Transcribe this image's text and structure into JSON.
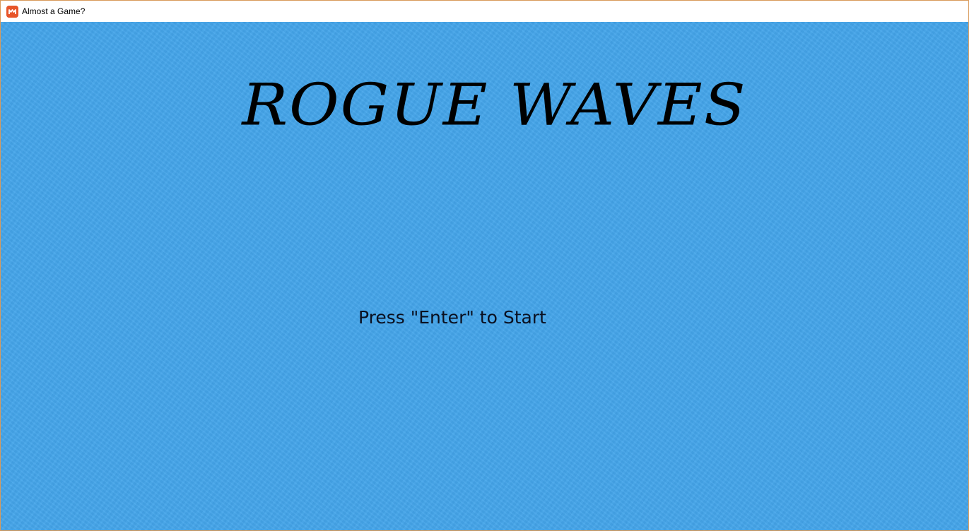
{
  "window": {
    "title": "Almost a Game?",
    "icon": "monogame-logo-icon"
  },
  "game": {
    "title": "ROGUE WAVES",
    "start_prompt": "Press \"Enter\" to Start",
    "background_color": "#44a5ea",
    "text_color": "#000000"
  }
}
